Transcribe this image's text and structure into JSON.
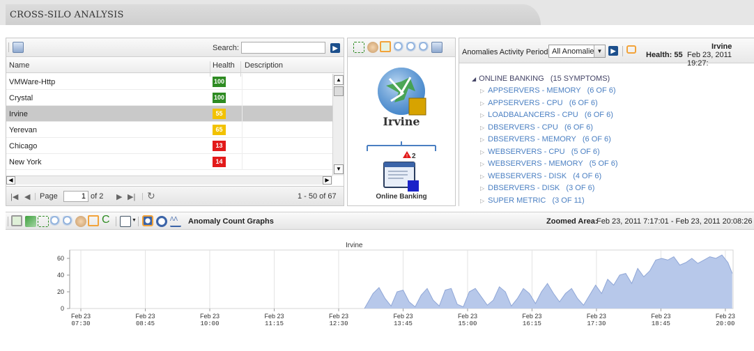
{
  "app": {
    "title": "CROSS-SILO ANALYSIS"
  },
  "list_panel": {
    "search_label": "Search:",
    "search_value": "",
    "columns": {
      "name": "Name",
      "health": "Health",
      "description": "Description"
    },
    "rows": [
      {
        "name": "VMWare-Http",
        "health": "100",
        "color": "#2e8b22",
        "selected": false
      },
      {
        "name": "Crystal",
        "health": "100",
        "color": "#2e8b22",
        "selected": false
      },
      {
        "name": "Irvine",
        "health": "55",
        "color": "#f2c200",
        "selected": true
      },
      {
        "name": "Yerevan",
        "health": "65",
        "color": "#f2c200",
        "selected": false
      },
      {
        "name": "Chicago",
        "health": "13",
        "color": "#e21a1a",
        "selected": false
      },
      {
        "name": "New York",
        "health": "14",
        "color": "#e21a1a",
        "selected": false
      }
    ],
    "pager": {
      "page_label": "Page",
      "page_value": "1",
      "of_label": "of 2",
      "range": "1 - 50 of 67"
    }
  },
  "topology": {
    "root_label": "Irvine",
    "child_label": "Online Banking",
    "alert_count": "2"
  },
  "anomalies": {
    "period_label": "Anomalies Activity Period:",
    "period_value": "All Anomalies",
    "entity_name": "Irvine",
    "health_label": "Health: 55",
    "timestamp": "Feb 23, 2011 19:27:",
    "root": "ONLINE BANKING   (15 SYMPTOMS)",
    "items": [
      "APPSERVERS - MEMORY   (6 OF 6)",
      "APPSERVERS - CPU   (6 OF 6)",
      "LOADBALANCERS - CPU   (6 OF 6)",
      "DBSERVERS - CPU   (6 OF 6)",
      "DBSERVERS - MEMORY   (6 OF 6)",
      "WEBSERVERS - CPU   (5 OF 6)",
      "WEBSERVERS - MEMORY   (5 OF 6)",
      "WEBSERVERS - DISK   (4 OF 6)",
      "DBSERVERS - DISK   (3 OF 6)",
      "SUPER METRIC   (3 OF 11)"
    ]
  },
  "graph_toolbar": {
    "title": "Anomaly Count Graphs",
    "zoomed_label": "Zoomed Area:",
    "zoomed_value": "Feb 23, 2011 7:17:01 - Feb 23, 2011 20:08:26"
  },
  "chart_data": {
    "type": "area",
    "title": "Irvine",
    "ylim": [
      0,
      70
    ],
    "yticks": [
      "60",
      "40",
      "20",
      "0"
    ],
    "xtick_dates": [
      "Feb 23",
      "Feb 23",
      "Feb 23",
      "Feb 23",
      "Feb 23",
      "Feb 23",
      "Feb 23",
      "Feb 23",
      "Feb 23",
      "Feb 23",
      "Feb 23"
    ],
    "xtick_times": [
      "07:30",
      "08:45",
      "10:00",
      "11:15",
      "12:30",
      "13:45",
      "15:00",
      "16:15",
      "17:30",
      "18:45",
      "20:00"
    ],
    "color": "#b7c8ea",
    "series": [
      {
        "x": [
          "13:00",
          "13:10",
          "13:17",
          "13:24",
          "13:31",
          "13:38",
          "13:45",
          "13:52",
          "13:59",
          "14:06",
          "14:13",
          "14:20",
          "14:27",
          "14:34",
          "14:41",
          "14:48",
          "14:55",
          "15:02",
          "15:09",
          "15:16",
          "15:23",
          "15:30",
          "15:37",
          "15:44",
          "15:51",
          "15:58",
          "16:05",
          "16:12",
          "16:19",
          "16:26",
          "16:33",
          "16:40",
          "16:47",
          "16:54",
          "17:01",
          "17:08",
          "17:15",
          "17:22",
          "17:29",
          "17:36",
          "17:43",
          "17:50",
          "17:57",
          "18:04",
          "18:11",
          "18:18",
          "18:25",
          "18:32",
          "18:39",
          "18:46",
          "18:53",
          "19:00",
          "19:07",
          "19:14",
          "19:21",
          "19:28",
          "19:35",
          "19:42",
          "19:49",
          "19:56",
          "20:03",
          "20:08"
        ],
        "values": [
          0,
          18,
          25,
          12,
          3,
          20,
          22,
          8,
          2,
          16,
          24,
          10,
          3,
          22,
          24,
          5,
          2,
          20,
          24,
          14,
          4,
          10,
          26,
          20,
          3,
          12,
          24,
          18,
          6,
          20,
          30,
          18,
          8,
          18,
          24,
          12,
          4,
          16,
          28,
          18,
          35,
          28,
          40,
          42,
          30,
          48,
          38,
          45,
          58,
          60,
          58,
          62,
          52,
          55,
          60,
          54,
          58,
          62,
          60,
          64,
          55,
          42
        ]
      }
    ]
  }
}
